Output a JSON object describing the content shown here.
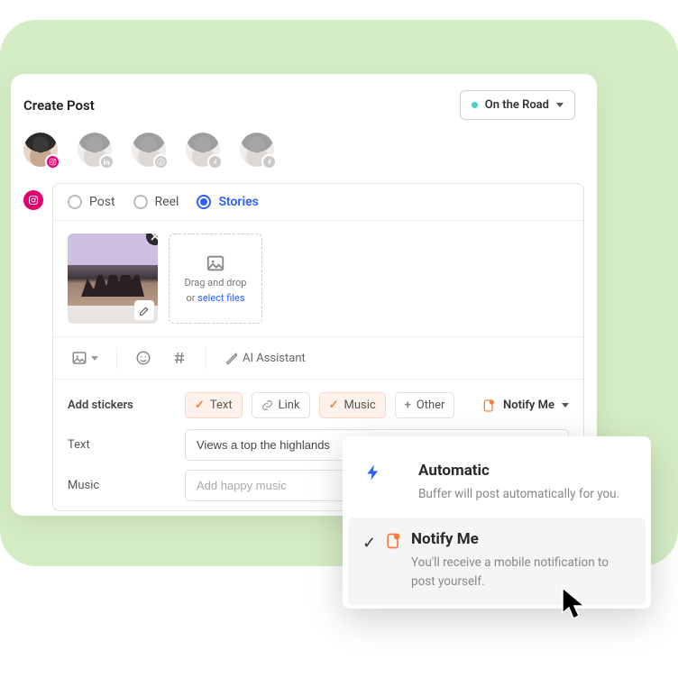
{
  "header": {
    "title": "Create Post",
    "project_label": "On the Road"
  },
  "channels": [
    {
      "network": "instagram",
      "active": true
    },
    {
      "network": "linkedin",
      "active": false
    },
    {
      "network": "pinterest",
      "active": false
    },
    {
      "network": "tiktok",
      "active": false
    },
    {
      "network": "facebook",
      "active": false
    }
  ],
  "post_types": {
    "options": [
      {
        "key": "post",
        "label": "Post",
        "selected": false
      },
      {
        "key": "reel",
        "label": "Reel",
        "selected": false
      },
      {
        "key": "stories",
        "label": "Stories",
        "selected": true
      }
    ]
  },
  "dropzone": {
    "line1": "Drag and drop",
    "line2_prefix": "or ",
    "line2_link": "select files"
  },
  "toolbar": {
    "ai_assistant_label": "AI Assistant"
  },
  "stickers": {
    "label": "Add stickers",
    "chips": [
      {
        "label": "Text",
        "lit": true,
        "icon": "check"
      },
      {
        "label": "Link",
        "lit": false,
        "icon": "link"
      },
      {
        "label": "Music",
        "lit": true,
        "icon": "check"
      },
      {
        "label": "Other",
        "lit": false,
        "icon": "plus"
      }
    ],
    "notify_label": "Notify Me"
  },
  "fields": {
    "text": {
      "label": "Text",
      "value": "Views a top the highlands"
    },
    "music": {
      "label": "Music",
      "placeholder": "Add happy music"
    }
  },
  "popover": {
    "automatic": {
      "title": "Automatic",
      "desc": "Buffer will post automatically for you."
    },
    "notify": {
      "title": "Notify Me",
      "desc": "You'll receive a mobile notification to post yourself."
    }
  }
}
